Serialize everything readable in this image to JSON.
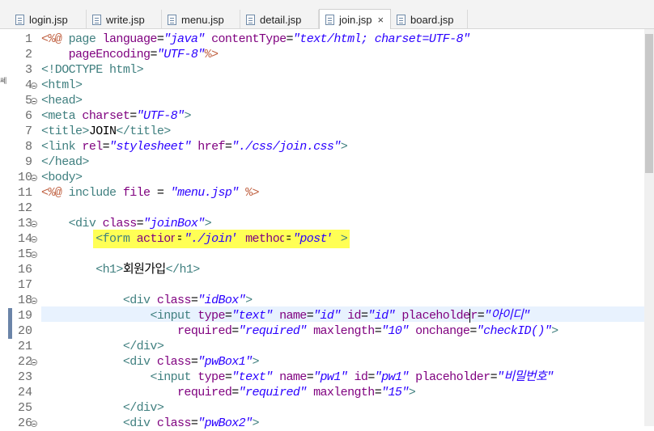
{
  "tabs": [
    {
      "label": "login.jsp",
      "active": false
    },
    {
      "label": "write.jsp",
      "active": false
    },
    {
      "label": "menu.jsp",
      "active": false
    },
    {
      "label": "detail.jsp",
      "active": false
    },
    {
      "label": "join.jsp",
      "active": true,
      "close": "×"
    },
    {
      "label": "board.jsp",
      "active": false
    }
  ],
  "side_text": "쎄",
  "line_numbers": [
    "1",
    "2",
    "3",
    "4",
    "5",
    "6",
    "7",
    "8",
    "9",
    "10",
    "11",
    "12",
    "13",
    "14",
    "15",
    "16",
    "17",
    "18",
    "19",
    "20",
    "21",
    "22",
    "23",
    "24",
    "25",
    "26"
  ],
  "code": [
    [
      {
        "t": "<%@ ",
        "c": "dr"
      },
      {
        "t": "page ",
        "c": "tg"
      },
      {
        "t": "language",
        "c": "at"
      },
      {
        "t": "=",
        "c": "tx"
      },
      {
        "t": "\"java\"",
        "c": "av"
      },
      {
        "t": " ",
        "c": "tx"
      },
      {
        "t": "contentType",
        "c": "at"
      },
      {
        "t": "=",
        "c": "tx"
      },
      {
        "t": "\"text/html; charset=UTF-8\"",
        "c": "av"
      }
    ],
    [
      {
        "t": "    ",
        "c": "tx"
      },
      {
        "t": "pageEncoding",
        "c": "at"
      },
      {
        "t": "=",
        "c": "tx"
      },
      {
        "t": "\"UTF-8\"",
        "c": "av"
      },
      {
        "t": "%>",
        "c": "dr"
      }
    ],
    [
      {
        "t": "<!DOCTYPE html>",
        "c": "tg"
      }
    ],
    [
      {
        "t": "<html>",
        "c": "tg"
      }
    ],
    [
      {
        "t": "<head>",
        "c": "tg"
      }
    ],
    [
      {
        "t": "<meta ",
        "c": "tg"
      },
      {
        "t": "charset",
        "c": "at"
      },
      {
        "t": "=",
        "c": "tx"
      },
      {
        "t": "\"UTF-8\"",
        "c": "av"
      },
      {
        "t": ">",
        "c": "tg"
      }
    ],
    [
      {
        "t": "<title>",
        "c": "tg"
      },
      {
        "t": "JOIN",
        "c": "tx"
      },
      {
        "t": "</title>",
        "c": "tg"
      }
    ],
    [
      {
        "t": "<link ",
        "c": "tg"
      },
      {
        "t": "rel",
        "c": "at"
      },
      {
        "t": "=",
        "c": "tx"
      },
      {
        "t": "\"stylesheet\"",
        "c": "av"
      },
      {
        "t": " ",
        "c": "tx"
      },
      {
        "t": "href",
        "c": "at"
      },
      {
        "t": "=",
        "c": "tx"
      },
      {
        "t": "\"./css/join.css\"",
        "c": "av"
      },
      {
        "t": ">",
        "c": "tg"
      }
    ],
    [
      {
        "t": "</head>",
        "c": "tg"
      }
    ],
    [
      {
        "t": "<body>",
        "c": "tg"
      }
    ],
    [
      {
        "t": "<%@ ",
        "c": "dr"
      },
      {
        "t": "include ",
        "c": "tg"
      },
      {
        "t": "file",
        "c": "at"
      },
      {
        "t": " = ",
        "c": "tx"
      },
      {
        "t": "\"menu.jsp\"",
        "c": "av"
      },
      {
        "t": " %>",
        "c": "dr"
      }
    ],
    [],
    [
      {
        "t": "    ",
        "c": "tx"
      },
      {
        "t": "<div ",
        "c": "tg"
      },
      {
        "t": "class",
        "c": "at"
      },
      {
        "t": "=",
        "c": "tx"
      },
      {
        "t": "\"joinBox\"",
        "c": "av"
      },
      {
        "t": ">",
        "c": "tg"
      }
    ],
    [
      {
        "t": "        ",
        "c": "tx"
      },
      {
        "t": "<form ",
        "c": "tg",
        "h": true
      },
      {
        "t": "action",
        "c": "at",
        "h": true
      },
      {
        "t": "=",
        "c": "tx",
        "h": true
      },
      {
        "t": "\"./join\"",
        "c": "av",
        "h": true
      },
      {
        "t": " ",
        "c": "tx",
        "h": true
      },
      {
        "t": "method",
        "c": "at",
        "h": true
      },
      {
        "t": "=",
        "c": "tx",
        "h": true
      },
      {
        "t": "\"post\"",
        "c": "av",
        "h": true
      },
      {
        "t": " >",
        "c": "tg",
        "h": true
      }
    ],
    [],
    [
      {
        "t": "        ",
        "c": "tx"
      },
      {
        "t": "<h1>",
        "c": "tg"
      },
      {
        "t": "회원가입",
        "c": "tx"
      },
      {
        "t": "</h1>",
        "c": "tg"
      }
    ],
    [],
    [
      {
        "t": "            ",
        "c": "tx"
      },
      {
        "t": "<div ",
        "c": "tg"
      },
      {
        "t": "class",
        "c": "at"
      },
      {
        "t": "=",
        "c": "tx"
      },
      {
        "t": "\"idBox\"",
        "c": "av"
      },
      {
        "t": ">",
        "c": "tg"
      }
    ],
    [
      {
        "t": "                ",
        "c": "tx"
      },
      {
        "t": "<input ",
        "c": "tg"
      },
      {
        "t": "type",
        "c": "at"
      },
      {
        "t": "=",
        "c": "tx"
      },
      {
        "t": "\"text\"",
        "c": "av"
      },
      {
        "t": " ",
        "c": "tx"
      },
      {
        "t": "name",
        "c": "at"
      },
      {
        "t": "=",
        "c": "tx"
      },
      {
        "t": "\"id\"",
        "c": "av"
      },
      {
        "t": " ",
        "c": "tx"
      },
      {
        "t": "id",
        "c": "at"
      },
      {
        "t": "=",
        "c": "tx"
      },
      {
        "t": "\"id\"",
        "c": "av"
      },
      {
        "t": " ",
        "c": "tx"
      },
      {
        "t": "placeholde",
        "c": "at"
      },
      {
        "caret": true
      },
      {
        "t": "r",
        "c": "at"
      },
      {
        "t": "=",
        "c": "tx"
      },
      {
        "t": "\"아이디\"",
        "c": "av"
      }
    ],
    [
      {
        "t": "                    ",
        "c": "tx"
      },
      {
        "t": "required",
        "c": "at"
      },
      {
        "t": "=",
        "c": "tx"
      },
      {
        "t": "\"required\"",
        "c": "av"
      },
      {
        "t": " ",
        "c": "tx"
      },
      {
        "t": "maxlength",
        "c": "at"
      },
      {
        "t": "=",
        "c": "tx"
      },
      {
        "t": "\"10\"",
        "c": "av"
      },
      {
        "t": " ",
        "c": "tx"
      },
      {
        "t": "onchange",
        "c": "at"
      },
      {
        "t": "=",
        "c": "tx"
      },
      {
        "t": "\"checkID()\"",
        "c": "av"
      },
      {
        "t": ">",
        "c": "tg"
      }
    ],
    [
      {
        "t": "            ",
        "c": "tx"
      },
      {
        "t": "</div>",
        "c": "tg"
      }
    ],
    [
      {
        "t": "            ",
        "c": "tx"
      },
      {
        "t": "<div ",
        "c": "tg"
      },
      {
        "t": "class",
        "c": "at"
      },
      {
        "t": "=",
        "c": "tx"
      },
      {
        "t": "\"pwBox1\"",
        "c": "av"
      },
      {
        "t": ">",
        "c": "tg"
      }
    ],
    [
      {
        "t": "                ",
        "c": "tx"
      },
      {
        "t": "<input ",
        "c": "tg"
      },
      {
        "t": "type",
        "c": "at"
      },
      {
        "t": "=",
        "c": "tx"
      },
      {
        "t": "\"text\"",
        "c": "av"
      },
      {
        "t": " ",
        "c": "tx"
      },
      {
        "t": "name",
        "c": "at"
      },
      {
        "t": "=",
        "c": "tx"
      },
      {
        "t": "\"pw1\"",
        "c": "av"
      },
      {
        "t": " ",
        "c": "tx"
      },
      {
        "t": "id",
        "c": "at"
      },
      {
        "t": "=",
        "c": "tx"
      },
      {
        "t": "\"pw1\"",
        "c": "av"
      },
      {
        "t": " ",
        "c": "tx"
      },
      {
        "t": "placeholder",
        "c": "at"
      },
      {
        "t": "=",
        "c": "tx"
      },
      {
        "t": "\"비밀번호\"",
        "c": "av"
      }
    ],
    [
      {
        "t": "                    ",
        "c": "tx"
      },
      {
        "t": "required",
        "c": "at"
      },
      {
        "t": "=",
        "c": "tx"
      },
      {
        "t": "\"required\"",
        "c": "av"
      },
      {
        "t": " ",
        "c": "tx"
      },
      {
        "t": "maxlength",
        "c": "at"
      },
      {
        "t": "=",
        "c": "tx"
      },
      {
        "t": "\"15\"",
        "c": "av"
      },
      {
        "t": ">",
        "c": "tg"
      }
    ],
    [
      {
        "t": "            ",
        "c": "tx"
      },
      {
        "t": "</div>",
        "c": "tg"
      }
    ],
    [
      {
        "t": "            ",
        "c": "tx"
      },
      {
        "t": "<div ",
        "c": "tg"
      },
      {
        "t": "class",
        "c": "at"
      },
      {
        "t": "=",
        "c": "tx"
      },
      {
        "t": "\"pwBox2\"",
        "c": "av"
      },
      {
        "t": ">",
        "c": "tg"
      }
    ]
  ]
}
